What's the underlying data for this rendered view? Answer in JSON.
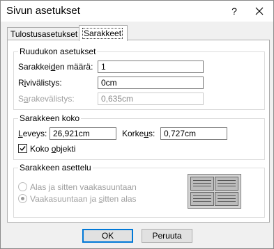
{
  "dialog": {
    "title": "Sivun asetukset",
    "help_label": "?",
    "close_icon": "close-icon"
  },
  "tabs": [
    {
      "label": "Tulostusasetukset",
      "active": false
    },
    {
      "label": "Sarakkeet",
      "active": true
    }
  ],
  "grid_settings": {
    "title": "Ruudukon asetukset",
    "column_count_label_pre": "Sarakkei",
    "column_count_label_u": "d",
    "column_count_label_post": "en määrä:",
    "column_count_value": "1",
    "row_spacing_label_pre": "R",
    "row_spacing_label_u": "i",
    "row_spacing_label_post": "vivälistys:",
    "row_spacing_value": "0cm",
    "column_spacing_label_pre": "S",
    "column_spacing_label_u": "a",
    "column_spacing_label_post": "rakevälistys:",
    "column_spacing_value": "0,635cm"
  },
  "column_size": {
    "title": "Sarakkeen koko",
    "width_label_u": "L",
    "width_label_post": "eveys:",
    "width_value": "26,921cm",
    "height_label_pre": "Korke",
    "height_label_u": "u",
    "height_label_post": "s:",
    "height_value": "0,727cm",
    "same_as_detail_pre": "Koko ",
    "same_as_detail_u": "o",
    "same_as_detail_post": "bjekti",
    "same_as_detail_checked": true
  },
  "column_layout": {
    "title": "Sarakkeen asettelu",
    "option1_pre": "Alas ",
    "option1_u": "j",
    "option1_post": "a sitten vaakasuuntaan",
    "option2_pre": "Vaakasuuntaan ja ",
    "option2_u": "s",
    "option2_post": "itten alas",
    "selected": "option2",
    "preview_icon": "column-layout-preview-icon"
  },
  "buttons": {
    "ok_label": "OK",
    "cancel_label": "Peruuta"
  }
}
